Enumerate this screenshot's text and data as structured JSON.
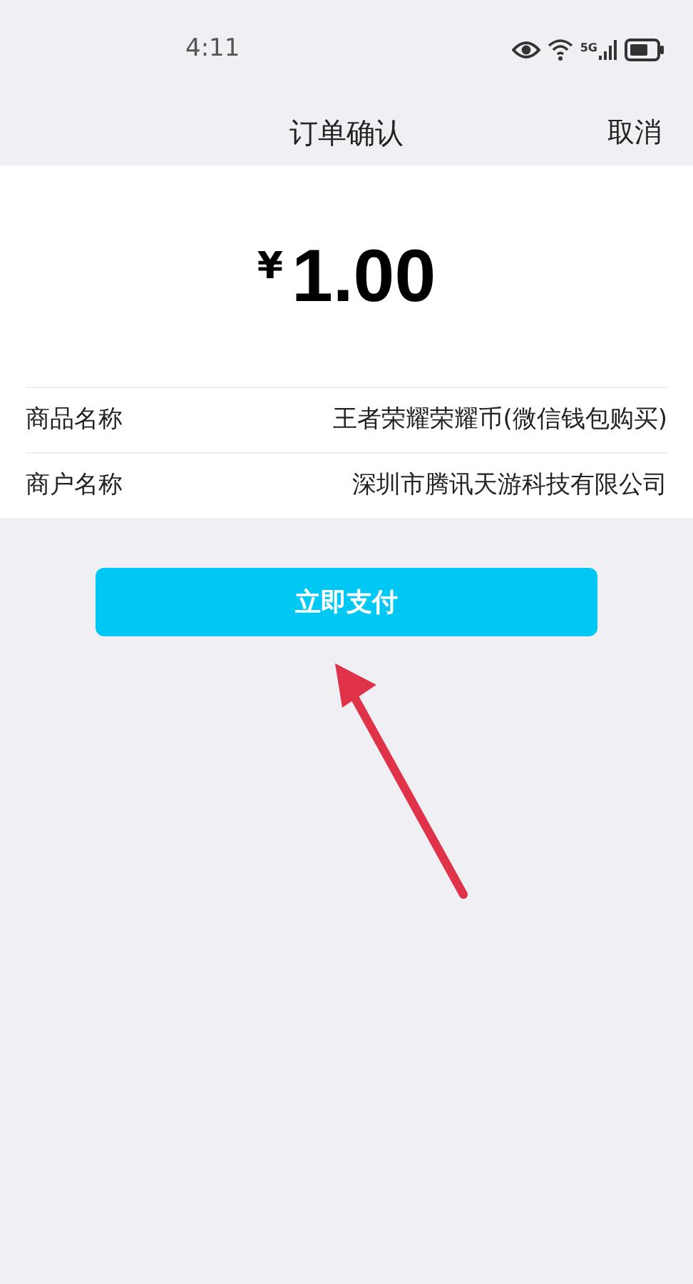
{
  "status_bar": {
    "time": "4:11",
    "network": "5G"
  },
  "header": {
    "title": "订单确认",
    "cancel": "取消"
  },
  "amount": {
    "currency": "¥",
    "value": "1.00"
  },
  "details": [
    {
      "label": "商品名称",
      "value": "王者荣耀荣耀币(微信钱包购买)"
    },
    {
      "label": "商户名称",
      "value": "深圳市腾讯天游科技有限公司"
    }
  ],
  "pay_button": "立即支付"
}
